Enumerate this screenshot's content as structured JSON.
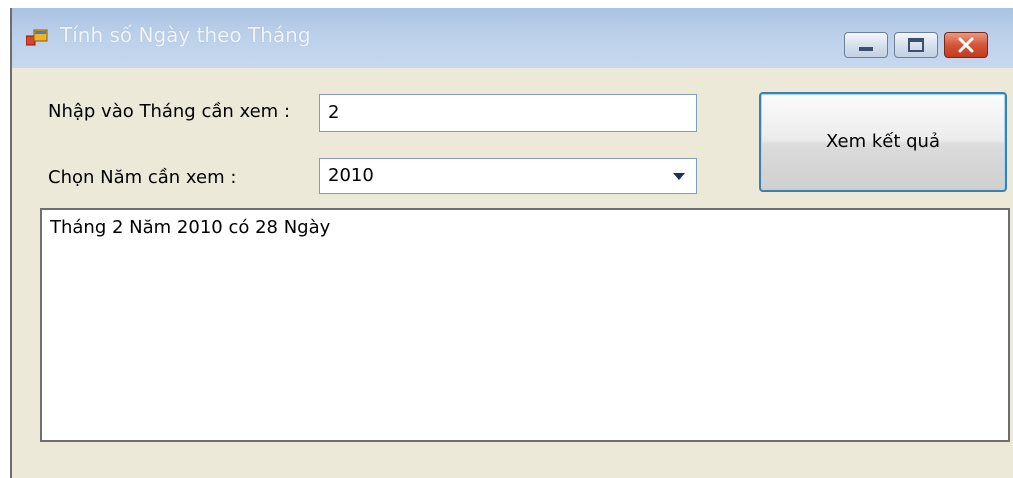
{
  "window": {
    "title": "Tính số Ngày theo Tháng"
  },
  "form": {
    "month_label": "Nhập vào Tháng cần xem :",
    "month_value": "2",
    "year_label": "Chọn Năm cần xem :",
    "year_selected": "2010",
    "submit_label": "Xem kết quả",
    "result_text": "Tháng 2 Năm 2010 có 28 Ngày"
  },
  "colors": {
    "titlebar": "#bcd0ea",
    "window_bg": "#ece9d8",
    "close_button": "#d4553a",
    "focus_border": "#3c7fb1"
  },
  "icons": {
    "app": "app-icon",
    "minimize": "minimize-icon",
    "maximize": "maximize-icon",
    "close": "close-icon",
    "dropdown": "chevron-down-icon"
  }
}
